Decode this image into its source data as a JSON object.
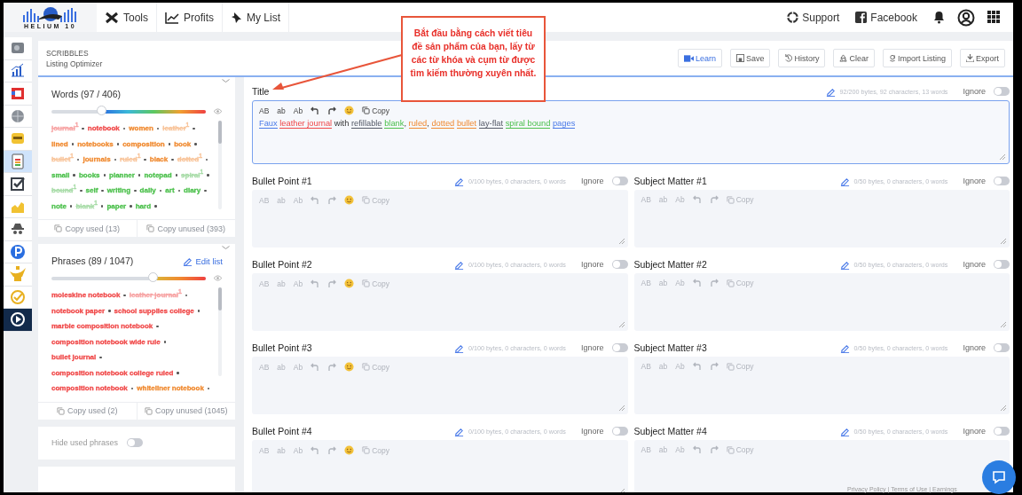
{
  "topbar": {
    "logo": "HELIUM 10",
    "nav": [
      {
        "label": "Tools"
      },
      {
        "label": "Profits"
      },
      {
        "label": "My List"
      }
    ],
    "links": [
      {
        "label": "Support"
      },
      {
        "label": "Facebook"
      }
    ]
  },
  "rail": [
    {
      "kind": "app",
      "selected": false
    },
    {
      "kind": "app",
      "selected": false
    },
    {
      "kind": "app",
      "selected": false
    },
    {
      "kind": "app",
      "selected": false
    },
    {
      "kind": "app",
      "selected": false
    },
    {
      "kind": "app",
      "selected": true
    },
    {
      "kind": "app",
      "selected": false
    },
    {
      "kind": "app",
      "selected": false
    },
    {
      "kind": "app",
      "selected": false
    },
    {
      "kind": "app",
      "selected": false
    },
    {
      "kind": "app",
      "selected": false
    },
    {
      "kind": "app",
      "selected": false
    },
    {
      "kind": "video",
      "selected": false
    }
  ],
  "header": {
    "section": "SCRIBBLES",
    "title": "Listing Optimizer",
    "buttons": [
      {
        "label": "Learn",
        "kind": "primary"
      },
      {
        "label": "Save",
        "kind": "default"
      },
      {
        "label": "History",
        "kind": "default"
      },
      {
        "label": "Clear",
        "kind": "default"
      },
      {
        "label": "Import Listing",
        "kind": "default"
      },
      {
        "label": "Export",
        "kind": "default"
      }
    ]
  },
  "words": {
    "heading": "Words (97 / 406)",
    "level": 0.33,
    "copy_used": "Copy used (13)",
    "copy_unused": "Copy unused (393)",
    "items": [
      {
        "text": "journal",
        "count": "1",
        "used": true,
        "color": "#f7a4a4"
      },
      {
        "text": "notebook",
        "used": false,
        "color": "#f04848"
      },
      {
        "text": "women",
        "used": false,
        "color": "#f08a30"
      },
      {
        "text": "leather",
        "count": "1",
        "used": true,
        "color": "#f8c49a"
      },
      {
        "text": "lined",
        "used": false,
        "color": "#f08a30"
      },
      {
        "text": "notebooks",
        "used": false,
        "color": "#f08a30"
      },
      {
        "text": "composition",
        "used": false,
        "color": "#f08a30"
      },
      {
        "text": "book",
        "used": false,
        "color": "#f08a30"
      },
      {
        "text": "bullet",
        "count": "1",
        "used": true,
        "color": "#f8c49a"
      },
      {
        "text": "journals",
        "used": false,
        "color": "#f08a30"
      },
      {
        "text": "ruled",
        "count": "1",
        "used": true,
        "color": "#f8c49a"
      },
      {
        "text": "black",
        "used": false,
        "color": "#f08a30"
      },
      {
        "text": "dotted",
        "count": "1",
        "used": true,
        "color": "#f8c49a"
      },
      {
        "text": "small",
        "used": false,
        "color": "#4cc04c"
      },
      {
        "text": "books",
        "used": false,
        "color": "#4cc04c"
      },
      {
        "text": "planner",
        "used": false,
        "color": "#4cc04c"
      },
      {
        "text": "notepad",
        "used": false,
        "color": "#4cc04c"
      },
      {
        "text": "spiral",
        "count": "1",
        "used": true,
        "color": "#a8dca8"
      },
      {
        "text": "bound",
        "count": "1",
        "used": true,
        "color": "#a8dca8"
      },
      {
        "text": "self",
        "used": false,
        "color": "#4cc04c"
      },
      {
        "text": "writing",
        "used": false,
        "color": "#4cc04c"
      },
      {
        "text": "daily",
        "used": false,
        "color": "#4cc04c"
      },
      {
        "text": "art",
        "used": false,
        "color": "#4cc04c"
      },
      {
        "text": "diary",
        "used": false,
        "color": "#4cc04c"
      },
      {
        "text": "note",
        "used": false,
        "color": "#4cc04c"
      },
      {
        "text": "blank",
        "count": "1",
        "used": true,
        "color": "#a8dca8"
      },
      {
        "text": "paper",
        "used": false,
        "color": "#4cc04c"
      },
      {
        "text": "hard",
        "used": false,
        "color": "#4cc04c"
      }
    ]
  },
  "phrases": {
    "heading": "Phrases (89 / 1047)",
    "edit": "Edit list",
    "level": 0.66,
    "copy_used": "Copy used (2)",
    "copy_unused": "Copy unused (1045)",
    "items": [
      {
        "text": "moleskine notebook",
        "used": false,
        "color": "#f04848"
      },
      {
        "text": "leather journal",
        "count": "1",
        "used": true,
        "color": "#f7a4a4"
      },
      {
        "text": "notebook paper",
        "used": false,
        "color": "#f04848"
      },
      {
        "text": "school supplies college",
        "used": false,
        "color": "#f04848"
      },
      {
        "text": "marble composition notebook",
        "used": false,
        "color": "#f04848"
      },
      {
        "text": "composition notebook wide rule",
        "used": false,
        "color": "#f04848"
      },
      {
        "text": "bullet journal",
        "used": false,
        "color": "#f04848"
      },
      {
        "text": "composition notebook college ruled",
        "used": false,
        "color": "#f04848"
      },
      {
        "text": "composition notebook",
        "used": false,
        "color": "#f04848"
      },
      {
        "text": "whiteliner notebook",
        "used": false,
        "color": "#f08a30"
      }
    ]
  },
  "hide_used": {
    "label": "Hide used phrases",
    "on": false
  },
  "fields": [
    {
      "label": "Title",
      "stats": "92/200 bytes, 92 characters, 13 words",
      "ignore_label": "Ignore",
      "ignore": false,
      "focused": true,
      "wide": true,
      "tools": [
        "AB",
        "ab",
        "Ab"
      ],
      "emoji": true,
      "copy": "Copy",
      "segments": [
        {
          "text": "Faux",
          "color": "#4a7ae8"
        },
        {
          "text": "leather journal",
          "color": "#f04848"
        },
        {
          "text": "with"
        },
        {
          "text": "refillable",
          "color": "#555a66"
        },
        {
          "text": "blank",
          "color": "#4cc04c"
        },
        {
          "text": ",",
          "kind": "punct"
        },
        {
          "text": "ruled",
          "color": "#f08a30"
        },
        {
          "text": ",",
          "kind": "punct"
        },
        {
          "text": "dotted",
          "color": "#f08a30"
        },
        {
          "text": "bullet",
          "color": "#f08a30"
        },
        {
          "text": "lay-flat",
          "color": "#555a66"
        },
        {
          "text": "spiral bound",
          "color": "#4cc04c"
        },
        {
          "text": "pages",
          "color": "#4a7ae8"
        }
      ]
    },
    {
      "label": "Bullet Point #1",
      "stats": "0/100 bytes, 0 characters, 0 words",
      "ignore_label": "Ignore",
      "ignore": false,
      "focused": false,
      "wide": false,
      "tools": [
        "AB",
        "ab",
        "Ab"
      ],
      "emoji": true,
      "copy": "Copy"
    },
    {
      "label": "Subject Matter #1",
      "stats": "0/50 bytes, 0 characters, 0 words",
      "ignore_label": "Ignore",
      "ignore": false,
      "focused": false,
      "wide": false,
      "tools": [
        "AB",
        "ab",
        "Ab"
      ],
      "emoji": false,
      "copy": "Copy"
    },
    {
      "label": "Bullet Point #2",
      "stats": "0/100 bytes, 0 characters, 0 words",
      "ignore_label": "Ignore",
      "ignore": false,
      "focused": false,
      "wide": false,
      "tools": [
        "AB",
        "ab",
        "Ab"
      ],
      "emoji": true,
      "copy": "Copy"
    },
    {
      "label": "Subject Matter #2",
      "stats": "0/50 bytes, 0 characters, 0 words",
      "ignore_label": "Ignore",
      "ignore": false,
      "focused": false,
      "wide": false,
      "tools": [
        "AB",
        "ab",
        "Ab"
      ],
      "emoji": false,
      "copy": "Copy"
    },
    {
      "label": "Bullet Point #3",
      "stats": "0/100 bytes, 0 characters, 0 words",
      "ignore_label": "Ignore",
      "ignore": false,
      "focused": false,
      "wide": false,
      "tools": [
        "AB",
        "ab",
        "Ab"
      ],
      "emoji": true,
      "copy": "Copy"
    },
    {
      "label": "Subject Matter #3",
      "stats": "0/50 bytes, 0 characters, 0 words",
      "ignore_label": "Ignore",
      "ignore": false,
      "focused": false,
      "wide": false,
      "tools": [
        "AB",
        "ab",
        "Ab"
      ],
      "emoji": false,
      "copy": "Copy"
    },
    {
      "label": "Bullet Point #4",
      "stats": "0/100 bytes, 0 characters, 0 words",
      "ignore_label": "Ignore",
      "ignore": false,
      "focused": false,
      "wide": false,
      "tools": [
        "AB",
        "ab",
        "Ab"
      ],
      "emoji": true,
      "copy": "Copy"
    },
    {
      "label": "Subject Matter #4",
      "stats": "0/50 bytes, 0 characters, 0 words",
      "ignore_label": "Ignore",
      "ignore": false,
      "focused": false,
      "wide": false,
      "tools": [
        "AB",
        "ab",
        "Ab"
      ],
      "emoji": false,
      "copy": "Copy"
    }
  ],
  "callout": {
    "text": "Bắt đầu bằng cách viết tiêu đề sản phẩm của bạn, lấy từ các từ khóa và cụm từ được tìm kiếm thường xuyên nhất."
  },
  "footer": "Privacy Policy | Terms of Use | Earnings"
}
